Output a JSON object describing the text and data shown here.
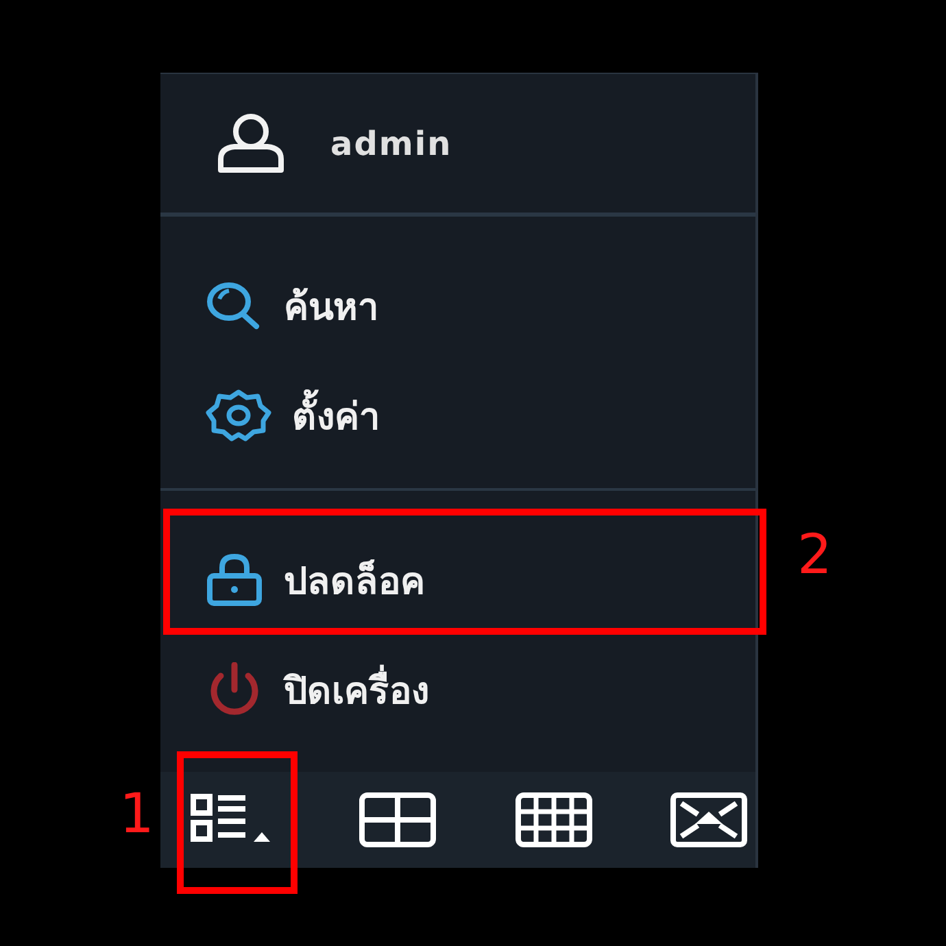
{
  "user": {
    "name": "admin"
  },
  "menu_groups": [
    {
      "items": [
        {
          "kind": "search",
          "label": "ค้นหา"
        },
        {
          "kind": "settings",
          "label": "ตั้งค่า"
        }
      ]
    },
    {
      "items": [
        {
          "kind": "unlock",
          "label": "ปลดล็อค",
          "callout": "2"
        },
        {
          "kind": "shutdown",
          "label": "ปิดเครื่อง"
        }
      ]
    }
  ],
  "toolbar": [
    {
      "kind": "menu",
      "callout": "1"
    },
    {
      "kind": "quad"
    },
    {
      "kind": "grid"
    },
    {
      "kind": "fullscreen"
    }
  ]
}
